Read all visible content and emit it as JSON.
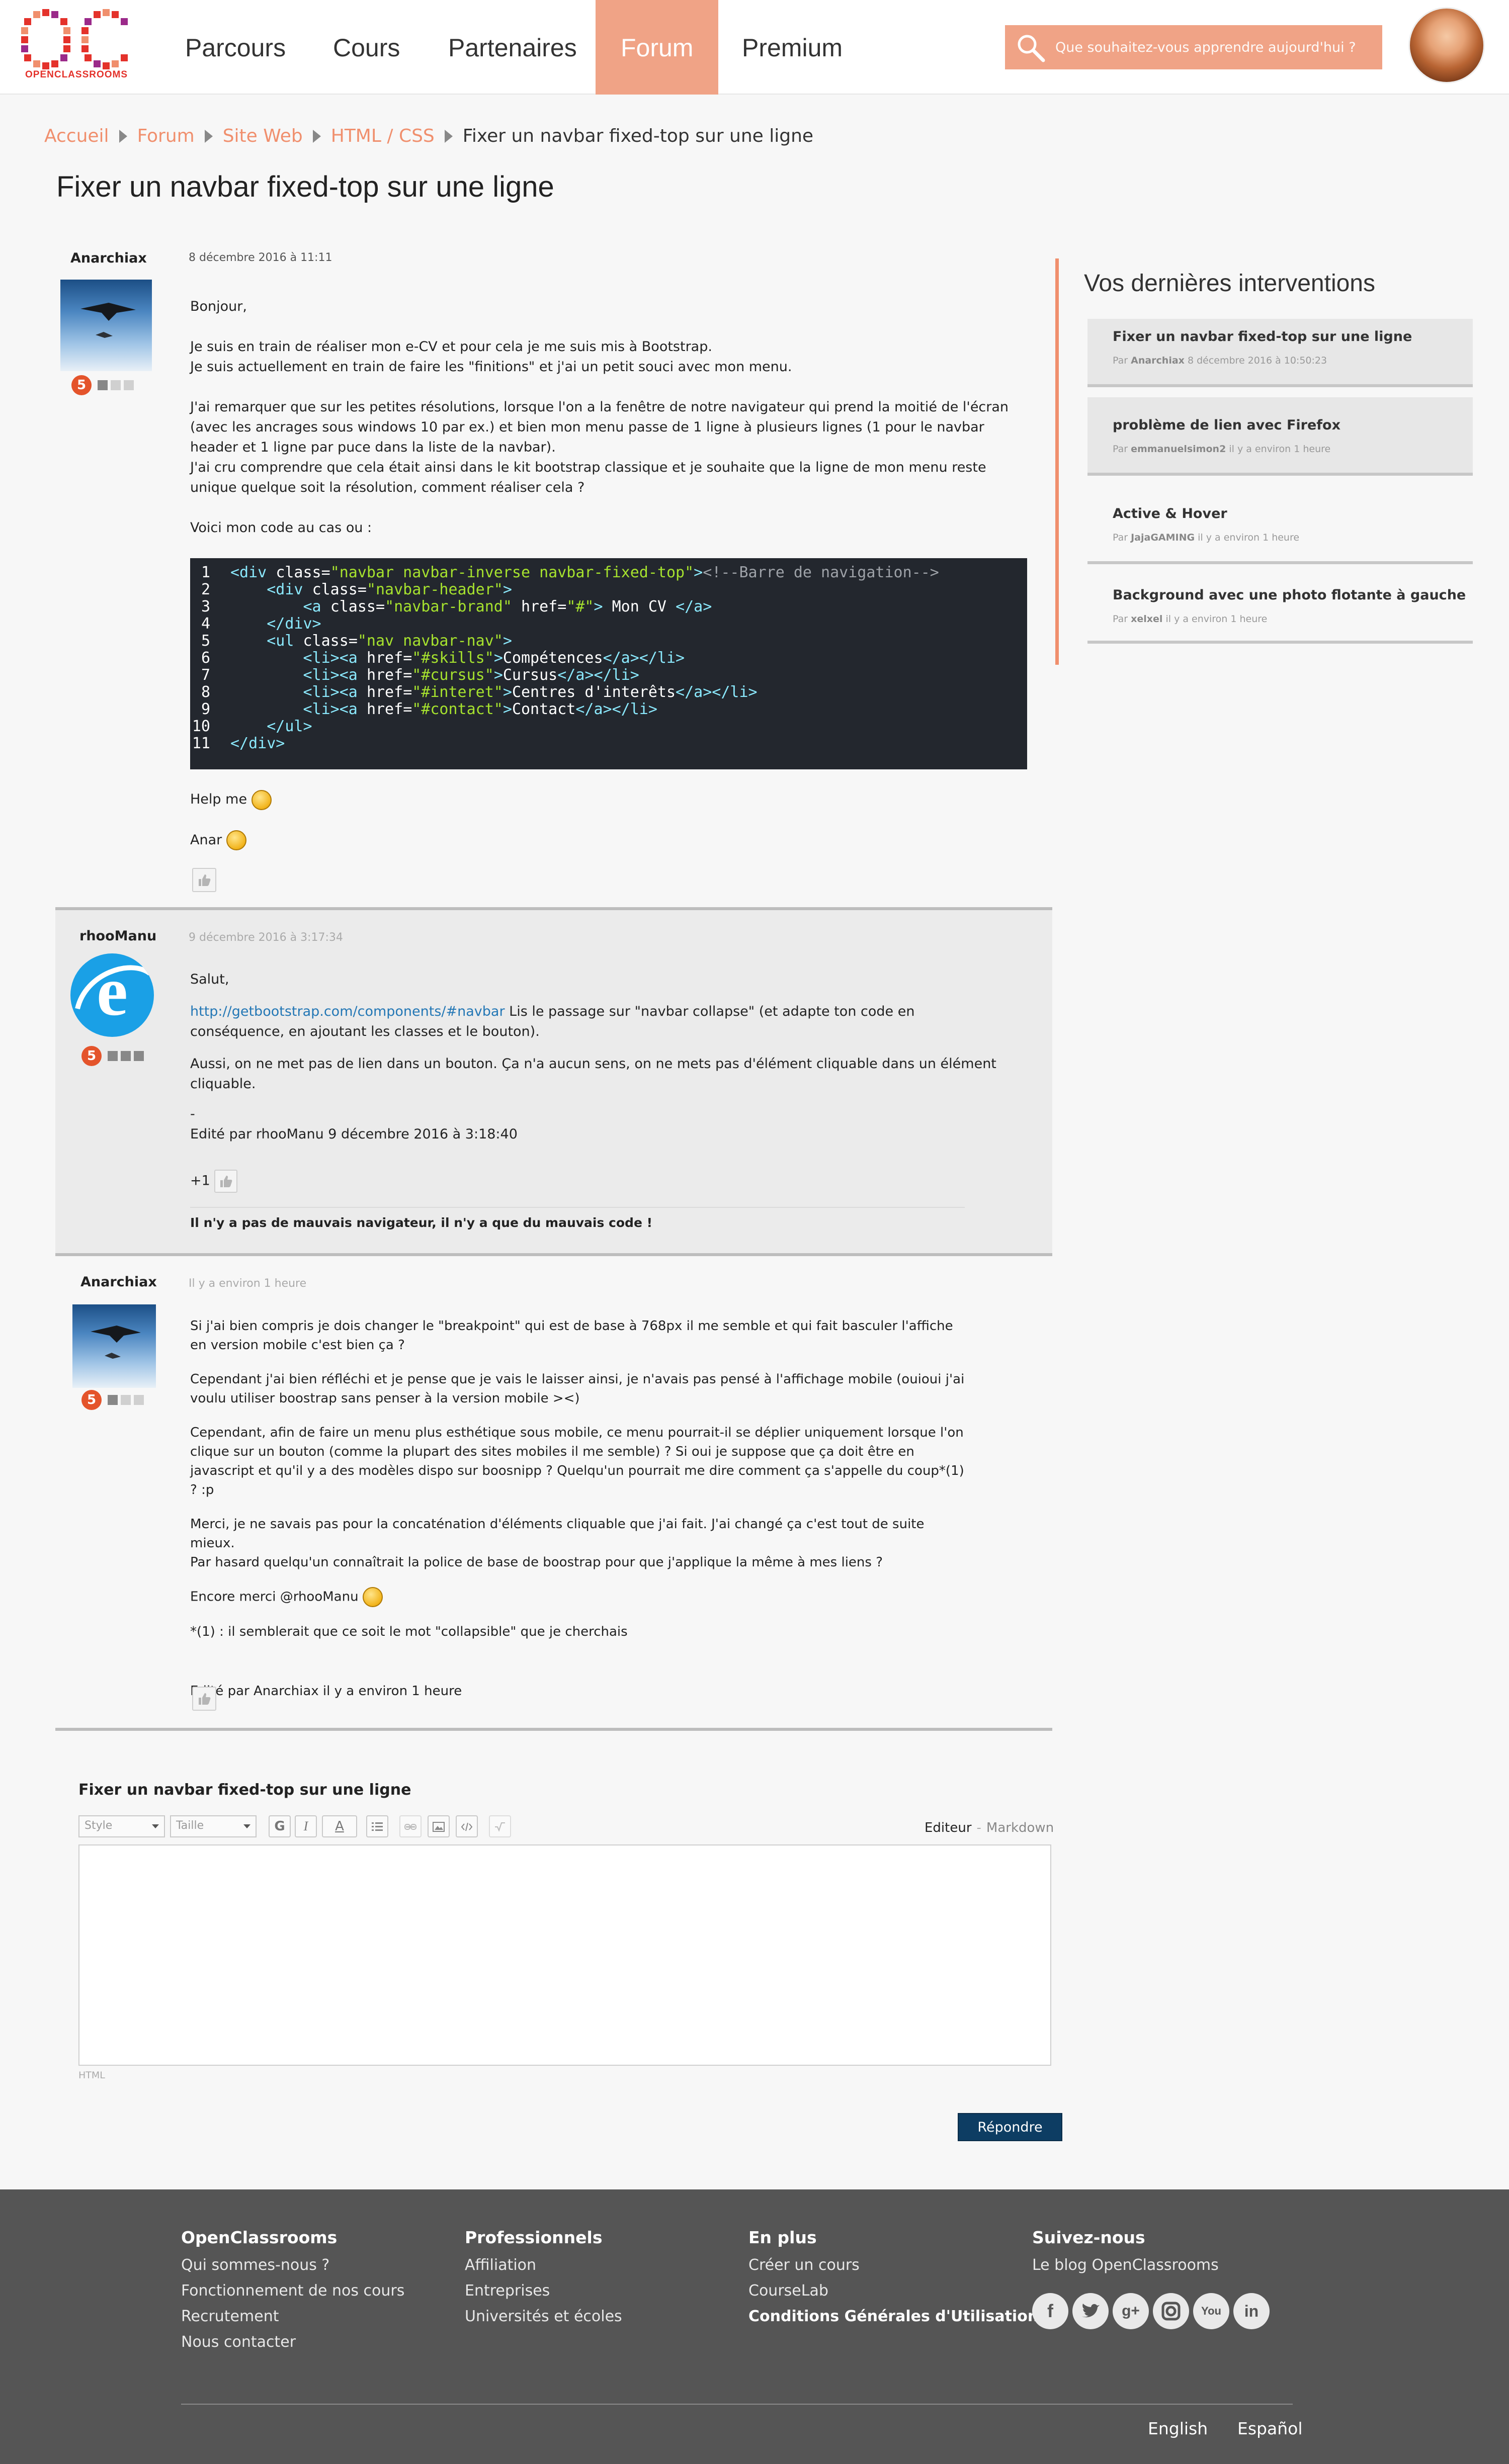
{
  "header": {
    "logo_text": "OPENCLASSROOMS",
    "nav": [
      "Parcours",
      "Cours",
      "Partenaires",
      "Forum",
      "Premium"
    ],
    "active_nav": "Forum",
    "search_placeholder": "Que souhaitez-vous apprendre aujourd'hui ?",
    "accent_color": "#f0a386"
  },
  "breadcrumb": [
    "Accueil",
    "Forum",
    "Site Web",
    "HTML / CSS",
    "Fixer un navbar fixed-top sur une ligne"
  ],
  "page_title": "Fixer un navbar fixed-top sur une ligne",
  "posts": [
    {
      "author": "Anarchiax",
      "date": "8 décembre 2016 à 11:11",
      "paragraphs": [
        "Bonjour,",
        "Je suis en train de réaliser mon e-CV et pour cela je me suis mis à Bootstrap.",
        "Je suis actuellement en train de faire les \"finitions\" et j'ai un petit souci avec mon menu.",
        "J'ai remarquer que sur les petites résolutions, lorsque l'on a la fenêtre de notre navigateur qui prend la moitié de l'écran (avec les ancrages sous windows 10 par ex.) et bien mon menu passe de 1 ligne à plusieurs lignes (1 pour le navbar header et 1 ligne par puce dans la liste de la navbar).",
        "J'ai cru comprendre que cela était ainsi dans le kit bootstrap classique et je souhaite que la ligne de mon menu reste unique quelque soit la résolution, comment réaliser cela ?",
        "Voici mon code au cas ou :"
      ],
      "code": [
        "<div class=\"navbar navbar-inverse navbar-fixed-top\"><!--Barre de navigation-->",
        "    <div class=\"navbar-header\">",
        "        <a class=\"navbar-brand\" href=\"#\"> Mon CV </a>",
        "    </div>",
        "    <ul class=\"nav navbar-nav\">",
        "        <li><a href=\"#skills\">Compétences</a></li>",
        "        <li><a href=\"#cursus\">Cursus</a></li>",
        "        <li><a href=\"#interet\">Centres d'interêts</a></li>",
        "        <li><a href=\"#contact\">Contact</a></li>",
        "    </ul>",
        "</div>"
      ],
      "closing": [
        "Help me",
        "Anar"
      ]
    },
    {
      "author": "rhooManu",
      "date": "9 décembre 2016 à 3:17:34",
      "salut": "Salut,",
      "link": "http://getbootstrap.com/components/#navbar",
      "link_after": "Lis le passage sur \"navbar collapse\" (et adapte ton code en conséquence, en ajoutant les classes et le bouton).",
      "para2": "Aussi, on ne met pas de lien dans un bouton. Ça n'a aucun sens, on ne mets pas d'élément cliquable dans un élément cliquable.",
      "dash": "-",
      "edited": "Edité par rhooManu 9 décembre 2016 à 3:18:40",
      "votes": "+1",
      "signature": "Il n'y a pas de mauvais navigateur, il n'y a que du mauvais code !"
    },
    {
      "author": "Anarchiax",
      "date": "Il y a environ 1 heure",
      "paragraphs": [
        "Si j'ai bien compris je dois changer le \"breakpoint\" qui est de base à 768px il me semble et qui fait basculer l'affiche en version mobile c'est bien ça ?",
        "Cependant j'ai bien réfléchi et je pense que je vais le laisser ainsi, je n'avais pas pensé à l'affichage mobile (ouioui j'ai voulu utiliser boostrap sans penser à la version mobile ><)",
        "Cependant, afin de faire un menu plus esthétique sous mobile, ce menu pourrait-il se déplier uniquement lorsque l'on clique sur un bouton (comme la plupart des sites mobiles il me semble) ? Si oui je suppose que ça doit être en javascript et qu'il y a des modèles dispo sur boosnipp ? Quelqu'un pourrait me dire comment ça s'appelle du coup*(1) ? :p",
        "Merci, je ne savais pas pour la concaténation d'éléments cliquable que j'ai fait. J'ai changé ça c'est tout de suite mieux.",
        "Par hasard quelqu'un connaîtrait la police de base de boostrap pour que j'applique la même à mes liens ?",
        "Encore merci @rhooManu",
        "*(1) : il semblerait que ce soit le mot \"collapsible\" que je cherchais"
      ],
      "edited": "Edité par Anarchiax il y a environ 1 heure"
    }
  ],
  "sidebar": {
    "title": "Vos dernières interventions",
    "items": [
      {
        "title": "Fixer un navbar fixed-top sur une ligne",
        "by": "Par",
        "user": "Anarchiax",
        "time": "8 décembre 2016 à 10:50:23"
      },
      {
        "title": "problème de lien avec Firefox",
        "by": "Par",
        "user": "emmanuelsimon2",
        "time": "il y a environ 1 heure"
      },
      {
        "title": "Active & Hover",
        "by": "Par",
        "user": "JajaGAMING",
        "time": "il y a environ 1 heure"
      },
      {
        "title": "Background avec une photo flotante à gauche",
        "by": "Par",
        "user": "xelxel",
        "time": "il y a environ 1 heure"
      }
    ]
  },
  "editor": {
    "title": "Fixer un navbar fixed-top sur une ligne",
    "style_select": "Style",
    "size_select": "Taille",
    "bold": "G",
    "italic": "I",
    "color": "A",
    "mode_active": "Editeur",
    "mode_sep": "-",
    "mode_inactive": "Markdown",
    "format": "HTML",
    "submit": "Répondre"
  },
  "footer": {
    "columns": [
      {
        "title": "OpenClassrooms",
        "links": [
          "Qui sommes-nous ?",
          "Fonctionnement de nos cours",
          "Recrutement",
          "Nous contacter"
        ]
      },
      {
        "title": "Professionnels",
        "links": [
          "Affiliation",
          "Entreprises",
          "Universités et écoles"
        ]
      },
      {
        "title": "En plus",
        "links": [
          "Créer un cours",
          "CourseLab",
          "Conditions Générales d'Utilisation"
        ]
      },
      {
        "title": "Suivez-nous",
        "links": [
          "Le blog OpenClassrooms"
        ]
      }
    ],
    "social": [
      "facebook-icon",
      "twitter-icon",
      "google-plus-icon",
      "instagram-icon",
      "youtube-icon",
      "linkedin-icon"
    ],
    "languages": [
      "English",
      "Español"
    ]
  }
}
